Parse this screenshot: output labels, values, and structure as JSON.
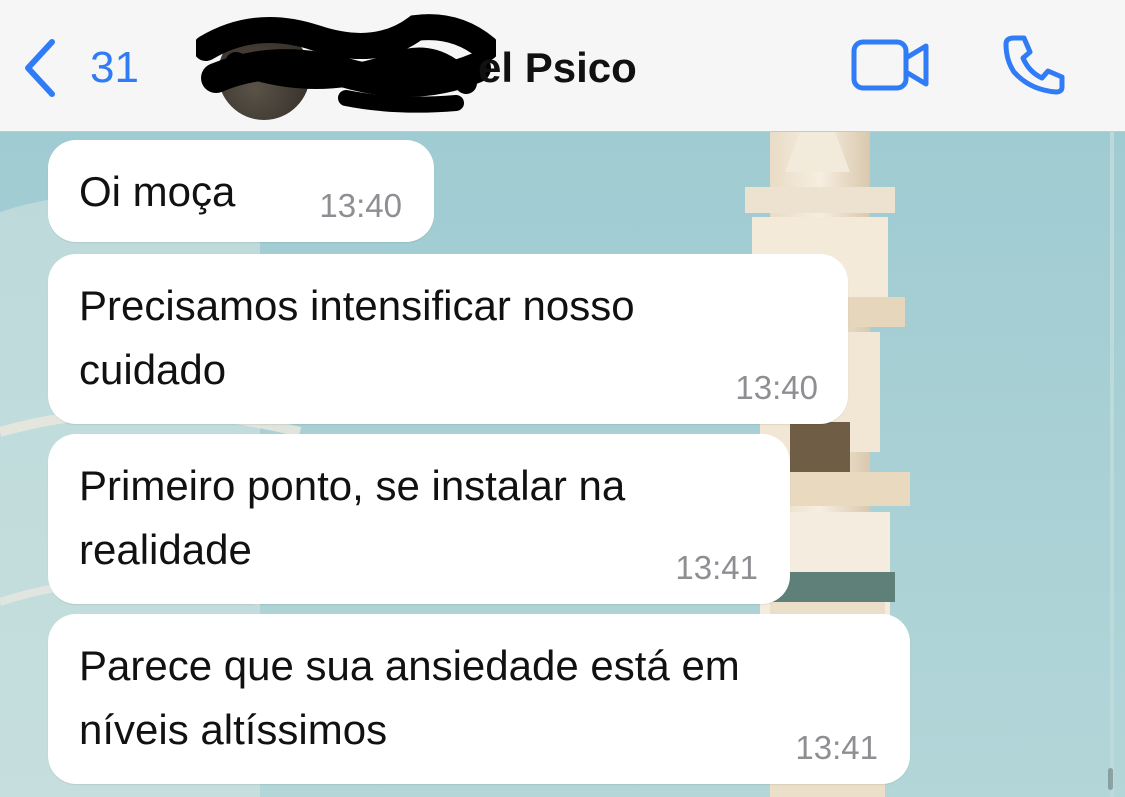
{
  "header": {
    "back_count": "31",
    "contact_name": "el Psico"
  },
  "messages": [
    {
      "text": "Oi moça",
      "time": "13:40"
    },
    {
      "text": "Precisamos intensificar nosso\ncuidado",
      "time": "13:40"
    },
    {
      "text": "Primeiro ponto, se instalar na\nrealidade",
      "time": "13:41"
    },
    {
      "text": "Parece que sua ansiedade está em\nníveis altíssimos",
      "time": "13:41"
    }
  ],
  "colors": {
    "accent": "#2f7cf6",
    "header_bg": "#f6f6f6",
    "bubble_bg": "#ffffff",
    "timestamp": "#8e8e93",
    "wallpaper_sky": "#a9cfd4"
  },
  "icons": {
    "back": "chevron-left-icon",
    "video": "video-camera-icon",
    "call": "phone-icon"
  }
}
